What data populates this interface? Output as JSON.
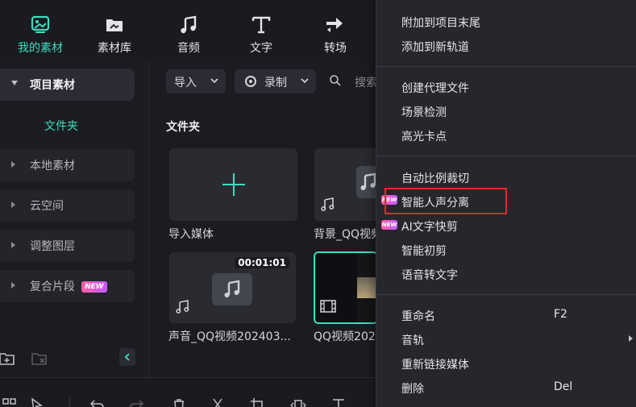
{
  "toolbar": {
    "tabs": [
      {
        "label": "我的素材",
        "icon": "my-media-icon",
        "active": true
      },
      {
        "label": "素材库",
        "icon": "stock-media-icon",
        "active": false
      },
      {
        "label": "音频",
        "icon": "music-note-icon",
        "active": false
      },
      {
        "label": "文字",
        "icon": "text-icon",
        "active": false
      },
      {
        "label": "转场",
        "icon": "transition-icon",
        "active": false
      }
    ]
  },
  "sidebar": {
    "project_label": "项目素材",
    "folder_label": "文件夹",
    "items": [
      {
        "label": "本地素材"
      },
      {
        "label": "云空间"
      },
      {
        "label": "调整图层"
      },
      {
        "label": "复合片段",
        "badge": "NEW"
      }
    ]
  },
  "main": {
    "import_label": "导入",
    "record_label": "录制",
    "search_placeholder": "搜索",
    "section_title": "文件夹",
    "cards": [
      {
        "caption": "导入媒体"
      },
      {
        "caption": "背景_QQ视频"
      },
      {
        "caption": "声音_QQ视频202403...",
        "duration": "00:01:01"
      },
      {
        "caption": "QQ视频202"
      }
    ]
  },
  "context_menu": {
    "items": [
      {
        "label": "附加到项目末尾"
      },
      {
        "label": "添加到新轨道"
      },
      {
        "label": "创建代理文件"
      },
      {
        "label": "场景检测"
      },
      {
        "label": "高光卡点"
      },
      {
        "label": "自动比例裁切"
      },
      {
        "label": "智能人声分离",
        "badge": "NEW",
        "highlighted": true
      },
      {
        "label": "AI文字快剪",
        "badge": "NEW"
      },
      {
        "label": "智能初剪"
      },
      {
        "label": "语音转文字"
      },
      {
        "label": "重命名",
        "shortcut": "F2"
      },
      {
        "label": "音轨",
        "submenu": true
      },
      {
        "label": "重新链接媒体"
      },
      {
        "label": "删除",
        "shortcut": "Del"
      }
    ]
  },
  "colors": {
    "accent": "#3fdcc0",
    "highlight_border": "#e02b2b",
    "menu_bg": "#26272d"
  }
}
